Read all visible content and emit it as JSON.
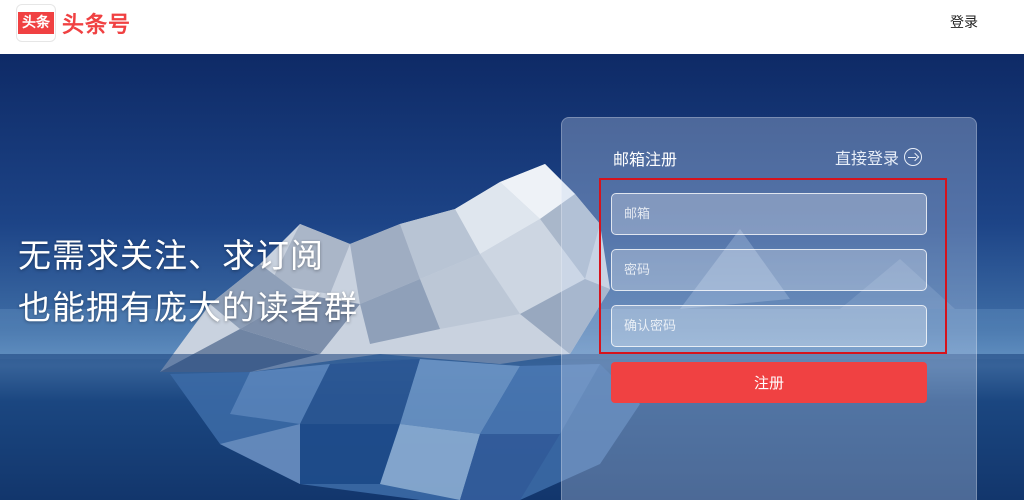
{
  "header": {
    "logo_badge": "头条",
    "logo_text": "头条号",
    "login_link": "登录"
  },
  "hero": {
    "slogan_line1": "无需求关注、求订阅",
    "slogan_line2": "也能拥有庞大的读者群"
  },
  "register_panel": {
    "title": "邮箱注册",
    "direct_login": "直接登录",
    "email_placeholder": "邮箱",
    "password_placeholder": "密码",
    "confirm_placeholder": "确认密码",
    "submit_label": "注册"
  },
  "colors": {
    "brand_red": "#f04142",
    "highlight_red": "#d6131c"
  }
}
